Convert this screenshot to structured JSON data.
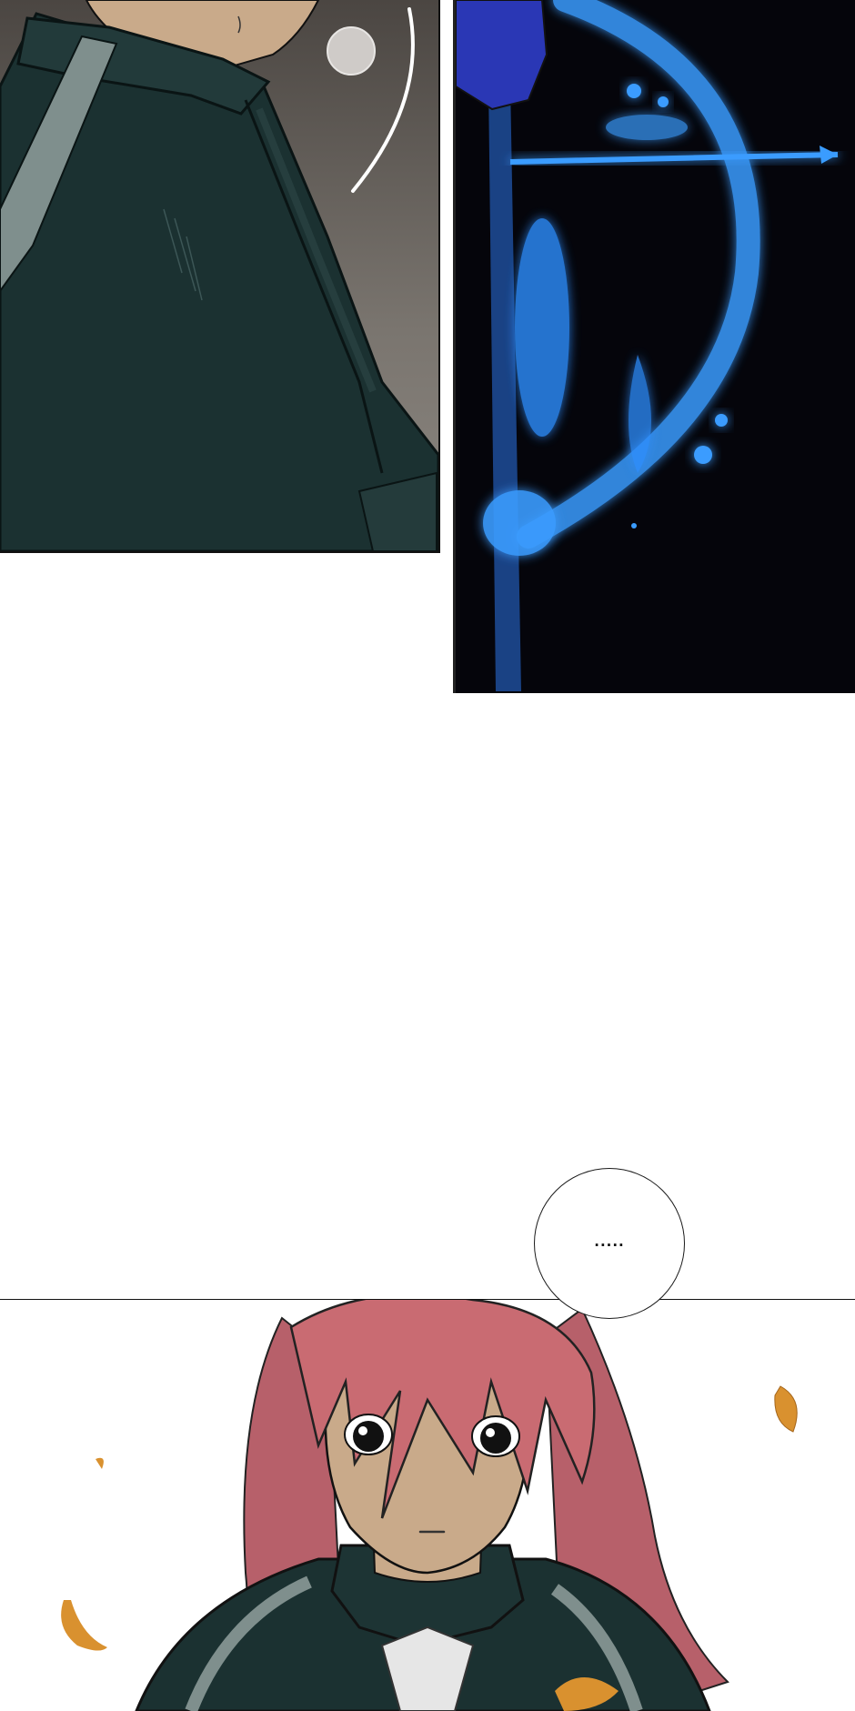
{
  "speech_bubble": {
    "text": "....."
  },
  "colors": {
    "page_background": "#ffffff",
    "jacket_dark_teal": "#1b3131",
    "jacket_stripe_gray": "#7f8f8d",
    "skin_tan": "#c9aa8a",
    "bow_glow_blue": "#3a9cff",
    "bow_panel_black": "#05050b",
    "hair_pink": "#c96b72",
    "leaf_orange": "#d9912f"
  },
  "panels": [
    {
      "name": "jacket-shoulder-closeup"
    },
    {
      "name": "glowing-blue-bow"
    },
    {
      "name": "red-haired-girl-portrait"
    }
  ]
}
